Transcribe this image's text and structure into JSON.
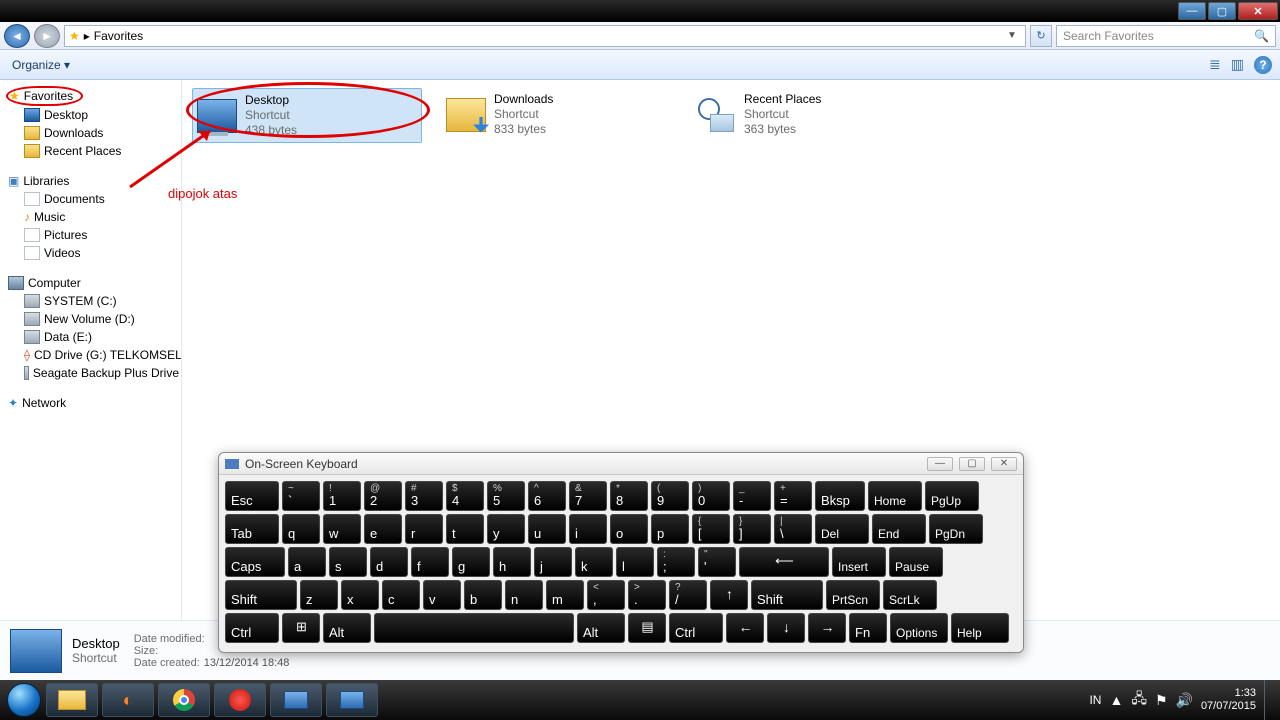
{
  "titlebar": {
    "min": "—",
    "max": "▢",
    "close": "✕"
  },
  "address": {
    "back": "◄",
    "fwd": "►",
    "sep": "▸",
    "loc": "Favorites",
    "drop": "▼",
    "refresh": "↻",
    "search_placeholder": "Search Favorites",
    "mag": "🔍"
  },
  "toolbar": {
    "organize": "Organize",
    "org_caret": "▾",
    "view": "≣",
    "preview": "▥",
    "help": "?"
  },
  "sidebar": {
    "favorites": {
      "label": "Favorites",
      "items": [
        "Desktop",
        "Downloads",
        "Recent Places"
      ]
    },
    "libraries": {
      "label": "Libraries",
      "items": [
        "Documents",
        "Music",
        "Pictures",
        "Videos"
      ]
    },
    "computer": {
      "label": "Computer",
      "items": [
        "SYSTEM (C:)",
        "New Volume (D:)",
        "Data (E:)",
        "CD Drive (G:) TELKOMSEL",
        "Seagate Backup Plus Drive"
      ]
    },
    "network": {
      "label": "Network"
    }
  },
  "content": {
    "items": [
      {
        "name": "Desktop",
        "type": "Shortcut",
        "size": "438 bytes"
      },
      {
        "name": "Downloads",
        "type": "Shortcut",
        "size": "833 bytes"
      },
      {
        "name": "Recent Places",
        "type": "Shortcut",
        "size": "363 bytes"
      }
    ]
  },
  "annotation": {
    "text": "dipojok atas"
  },
  "details": {
    "name": "Desktop",
    "type": "Shortcut",
    "mod_label": "Date modified:",
    "size_label": "Size:",
    "created_label": "Date created:",
    "created": "13/12/2014 18:48"
  },
  "osk": {
    "title": "On-Screen Keyboard",
    "row1": [
      {
        "l": "Esc"
      },
      {
        "l": "`",
        "s": "~"
      },
      {
        "l": "1",
        "s": "!"
      },
      {
        "l": "2",
        "s": "@"
      },
      {
        "l": "3",
        "s": "#"
      },
      {
        "l": "4",
        "s": "$"
      },
      {
        "l": "5",
        "s": "%"
      },
      {
        "l": "6",
        "s": "^"
      },
      {
        "l": "7",
        "s": "&"
      },
      {
        "l": "8",
        "s": "*"
      },
      {
        "l": "9",
        "s": "("
      },
      {
        "l": "0",
        "s": ")"
      },
      {
        "l": "-",
        "s": "_"
      },
      {
        "l": "=",
        "s": "+"
      },
      {
        "l": "Bksp"
      },
      {
        "l": "Home"
      },
      {
        "l": "PgUp"
      }
    ],
    "row2": [
      {
        "l": "Tab"
      },
      {
        "l": "q"
      },
      {
        "l": "w"
      },
      {
        "l": "e"
      },
      {
        "l": "r"
      },
      {
        "l": "t"
      },
      {
        "l": "y"
      },
      {
        "l": "u"
      },
      {
        "l": "i"
      },
      {
        "l": "o"
      },
      {
        "l": "p"
      },
      {
        "l": "[",
        "s": "{"
      },
      {
        "l": "]",
        "s": "}"
      },
      {
        "l": "\\",
        "s": "|"
      },
      {
        "l": "Del"
      },
      {
        "l": "End"
      },
      {
        "l": "PgDn"
      }
    ],
    "row3": [
      {
        "l": "Caps"
      },
      {
        "l": "a"
      },
      {
        "l": "s"
      },
      {
        "l": "d"
      },
      {
        "l": "f"
      },
      {
        "l": "g"
      },
      {
        "l": "h"
      },
      {
        "l": "j"
      },
      {
        "l": "k"
      },
      {
        "l": "l"
      },
      {
        "l": ";",
        "s": ":"
      },
      {
        "l": "'",
        "s": "\""
      },
      {
        "l": "⟵"
      },
      {
        "l": "Insert"
      },
      {
        "l": "Pause"
      }
    ],
    "row4": [
      {
        "l": "Shift"
      },
      {
        "l": "z"
      },
      {
        "l": "x"
      },
      {
        "l": "c"
      },
      {
        "l": "v"
      },
      {
        "l": "b"
      },
      {
        "l": "n"
      },
      {
        "l": "m"
      },
      {
        "l": ",",
        "s": "<"
      },
      {
        "l": ".",
        "s": ">"
      },
      {
        "l": "/",
        "s": "?"
      },
      {
        "l": "↑"
      },
      {
        "l": "Shift"
      },
      {
        "l": "PrtScn"
      },
      {
        "l": "ScrLk"
      }
    ],
    "row5": [
      {
        "l": "Ctrl"
      },
      {
        "l": "⊞"
      },
      {
        "l": "Alt"
      },
      {
        "l": ""
      },
      {
        "l": "Alt"
      },
      {
        "l": "▤"
      },
      {
        "l": "Ctrl"
      },
      {
        "l": "←"
      },
      {
        "l": "↓"
      },
      {
        "l": "→"
      },
      {
        "l": "Fn"
      },
      {
        "l": "Options"
      },
      {
        "l": "Help"
      }
    ]
  },
  "tray": {
    "lang": "IN",
    "flag": "▲",
    "net": "🖧",
    "act": "⚑",
    "vol": "🔊",
    "time": "1:33",
    "date": "07/07/2015"
  }
}
